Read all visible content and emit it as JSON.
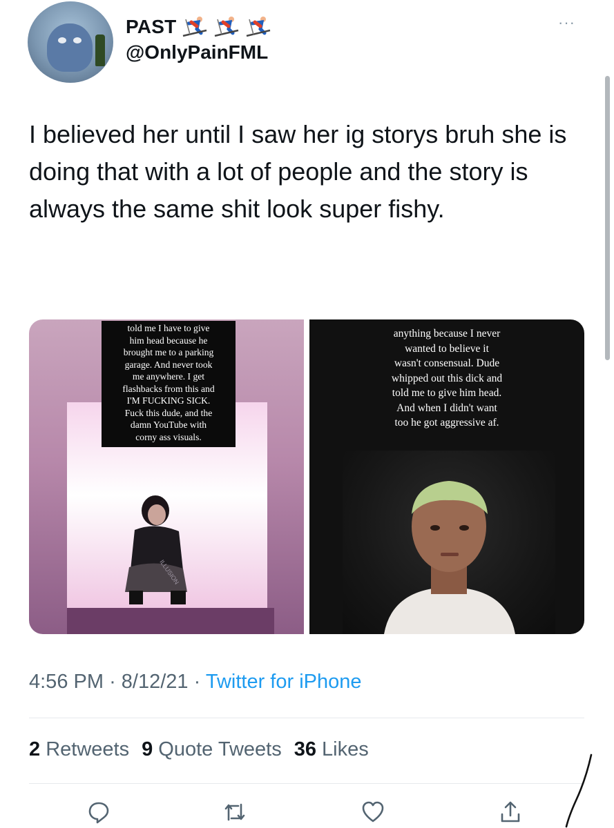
{
  "header": {
    "display_name": "PAST",
    "emojis": [
      "skier-icon",
      "skier-icon",
      "skier-icon"
    ],
    "handle": "@OnlyPainFML",
    "more_label": "···"
  },
  "tweet": {
    "text": "I believed her until I saw her ig storys bruh she is doing that with a lot of people and the story is always the same shit look super fishy."
  },
  "media": {
    "left_caption": "told me I have to give\nhim head because he\nbrought me to a parking\ngarage. And never took\nme anywhere. I get\nflashbacks from this and\nI'M FUCKING SICK.\nFuck this dude, and the\ndamn YouTube with\ncorny ass visuals.",
    "right_caption": "anything because I never\nwanted to believe it\nwasn't consensual. Dude\nwhipped out this dick and\ntold me to give him head.\nAnd when I didn't want\ntoo he got aggressive af.",
    "left_shirt_text": "ILLUSION"
  },
  "meta": {
    "time": "4:56 PM",
    "date": "8/12/21",
    "separator": "·",
    "source": "Twitter for iPhone"
  },
  "stats": {
    "retweets_count": "2",
    "retweets_label": "Retweets",
    "quotes_count": "9",
    "quotes_label": "Quote Tweets",
    "likes_count": "36",
    "likes_label": "Likes"
  },
  "actions": [
    "reply-icon",
    "retweet-icon",
    "like-icon",
    "share-icon"
  ],
  "colors": {
    "text": "#0f1419",
    "secondary": "#536471",
    "link": "#1d9bf0",
    "divider": "#e6e9ec"
  }
}
